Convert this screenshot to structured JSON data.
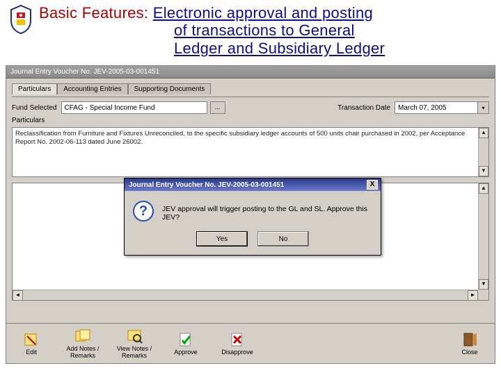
{
  "slide": {
    "prefix": "Basic Features: ",
    "title_l1": "Electronic approval and posting",
    "title_l2": "of transactions to General",
    "title_l3": "Ledger and Subsidiary Ledger"
  },
  "app": {
    "title": "Journal Entry Voucher No. JEV-2005-03-001451",
    "tabs": {
      "particulars": "Particulars",
      "entries": "Accounting Entries",
      "docs": "Supporting Documents"
    },
    "fund_label": "Fund Selected",
    "fund_value": "CFAG - Special Income Fund",
    "fund_browse": "...",
    "tx_label": "Transaction Date",
    "tx_value": "March   07, 2005",
    "particulars_label": "Particulars",
    "particulars_text": "Reclassification from Furniture and Fixtures Unreconciled, to the specific subsidiary ledger accounts of 500 units chair purchased in 2002, per Acceptance Report No. 2002-06-113 dated June  26002."
  },
  "modal": {
    "title": "Journal Entry Voucher No. JEV-2005-03-001451",
    "message": "JEV approval will trigger posting to the GL and SL.  Approve this JEV?",
    "yes": "Yes",
    "no": "No",
    "qmark": "?"
  },
  "toolbar": {
    "edit": "Edit",
    "add_notes": "Add Notes / Remarks",
    "view_notes": "View Notes / Remarks",
    "approve": "Approve",
    "disapprove": "Disapprove",
    "close": "Close"
  },
  "glyphs": {
    "chevron_down": "▾",
    "arrow_up": "▲",
    "arrow_down": "▼",
    "arrow_left": "◄",
    "arrow_right": "►",
    "x": "X"
  }
}
